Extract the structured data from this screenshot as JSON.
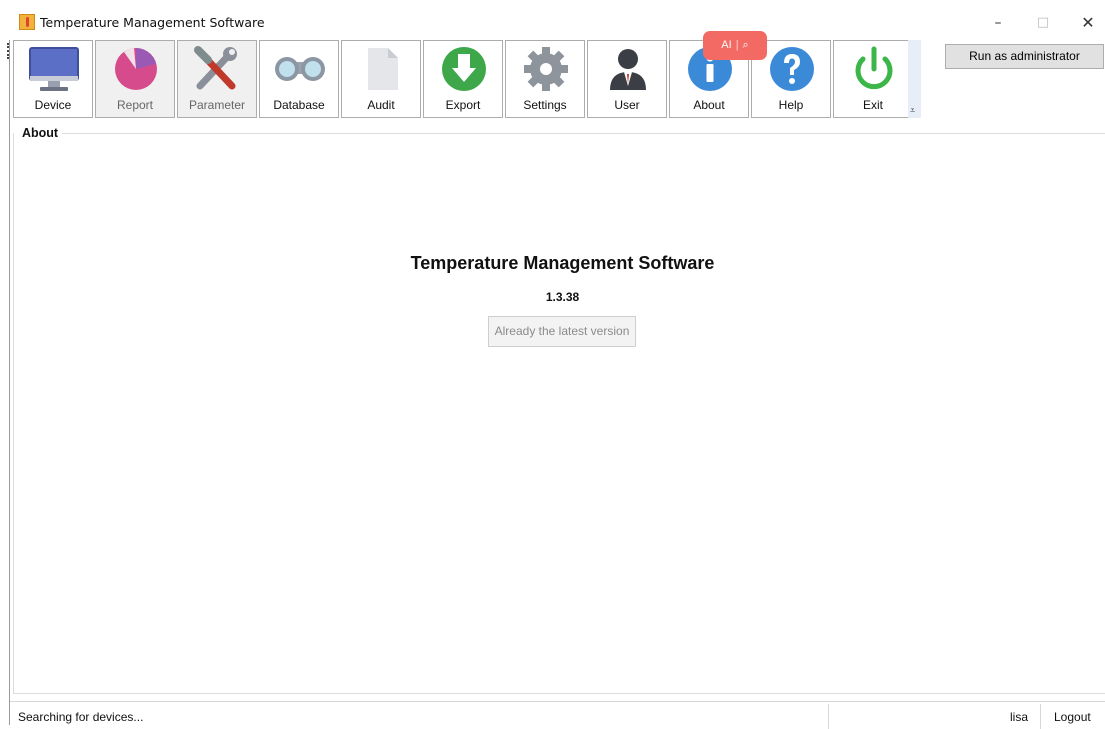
{
  "window": {
    "title": "Temperature Management Software",
    "controls": {
      "minimize": "–",
      "maximize": "□",
      "close": "✕"
    }
  },
  "toolbar": {
    "buttons": [
      {
        "label": "Device",
        "icon": "monitor-icon",
        "enabled": true
      },
      {
        "label": "Report",
        "icon": "pie-chart-icon",
        "enabled": false
      },
      {
        "label": "Parameter",
        "icon": "tools-icon",
        "enabled": false
      },
      {
        "label": "Database",
        "icon": "binoculars-icon",
        "enabled": true
      },
      {
        "label": "Audit",
        "icon": "document-icon",
        "enabled": true
      },
      {
        "label": "Export",
        "icon": "export-icon",
        "enabled": true
      },
      {
        "label": "Settings",
        "icon": "gear-icon",
        "enabled": true
      },
      {
        "label": "User",
        "icon": "user-icon",
        "enabled": true
      },
      {
        "label": "About",
        "icon": "info-icon",
        "enabled": true
      },
      {
        "label": "Help",
        "icon": "help-icon",
        "enabled": true
      },
      {
        "label": "Exit",
        "icon": "power-icon",
        "enabled": true
      }
    ],
    "overflow_glyph": "⩡"
  },
  "admin_button": "Run as administrator",
  "overlay": {
    "ai_label": "AI",
    "search_glyph": "⌕",
    "separator": "|"
  },
  "about": {
    "group_title": "About",
    "app_name": "Temperature Management Software",
    "version": "1.3.38",
    "update_button": "Already the latest version"
  },
  "statusbar": {
    "status": "Searching for devices...",
    "user": "lisa",
    "logout": "Logout"
  },
  "colors": {
    "monitor": "#5b6fc6",
    "pie": "#d64b8b",
    "export": "#3da74a",
    "info": "#3b8ad8",
    "power": "#3cb649",
    "ai_pill": "#f26a63"
  }
}
